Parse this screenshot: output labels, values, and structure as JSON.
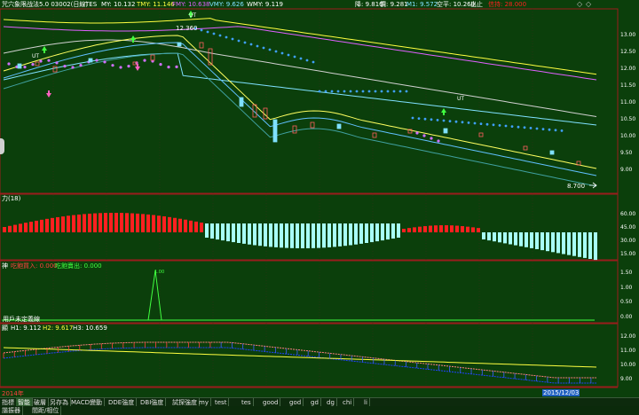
{
  "colors": {
    "bg": "#0b3f0b",
    "grid": "#4a1a1a",
    "axis": "#9b1c1c",
    "yellow": "#ffff40",
    "cyan": "#7fe0ff",
    "magenta": "#e060ff",
    "red": "#ff2020",
    "lightcyan": "#a8fff8",
    "blue": "#2040ff",
    "white": "#ffffff",
    "green": "#40ff40"
  },
  "main": {
    "title": "咒穴象限战法5.0 03002(日線)",
    "legend": [
      {
        "label": "TES",
        "color": "#ffffff"
      },
      {
        "label": "MY: 10.132",
        "color": "#ffffff"
      },
      {
        "label": "TMY: 11.146",
        "color": "#ffff40"
      },
      {
        "label": "FMY: 10.638",
        "color": "#e060ff"
      },
      {
        "label": "VMY: 9.626",
        "color": "#7fe0ff"
      },
      {
        "label": "WMY: 9.119",
        "color": "#ffffff"
      }
    ],
    "right_legend": [
      {
        "label": "降: 9.810",
        "color": "#ffffff"
      },
      {
        "label": "價: 9.281",
        "color": "#ffffff"
      },
      {
        "label": "M1: 9.572",
        "color": "#7fe0ff"
      },
      {
        "label": "空平: 10.260",
        "color": "#ffffff"
      },
      {
        "label": "出止",
        "color": "#ffffff"
      },
      {
        "label": "信持: 28.000",
        "color": "#ff2020"
      }
    ],
    "axis_labels": [
      "13.00",
      "12.50",
      "12.00",
      "11.50",
      "11.00",
      "10.50",
      "10.00",
      "9.50",
      "9.00"
    ],
    "annotations": {
      "high": "12.360",
      "low": "8.700",
      "ut1": "UT",
      "ut2": "UT",
      "ut3": "UT"
    }
  },
  "panel2": {
    "title": "力(18)",
    "axis_labels": [
      "60.00",
      "45.00",
      "30.00",
      "15.00"
    ]
  },
  "panel3": {
    "title_prefix": "神",
    "buy_label": "吃飽買入: 0.000",
    "sell_label": "吃飽賣出: 0.000",
    "bottom_note": "用戶未定義線",
    "axis_labels": [
      "1.50",
      "1.00",
      "0.50",
      "0.00"
    ],
    "spike_label": "1.00"
  },
  "panel4": {
    "title_prefix": "顯",
    "h1": "H1: 9.112",
    "h2": "H2: 9.617",
    "h3": "H3: 10.659",
    "axis_labels": [
      "12.00",
      "11.00",
      "10.00",
      "9.00"
    ]
  },
  "date_axis": {
    "left_label": "2014年",
    "right_label": "2015/12/03",
    "right_label_color": "#2060c0"
  },
  "tabs": [
    {
      "label": "指標",
      "active": false
    },
    {
      "label": "智能",
      "active": true
    },
    {
      "label": "破層",
      "active": false
    },
    {
      "label": "另存為",
      "active": false
    },
    {
      "label": "MACD變動",
      "active": false
    },
    {
      "label": "DDE強度",
      "active": false
    },
    {
      "label": "DBI強度",
      "active": false
    },
    {
      "label": "試探強度",
      "active": false
    },
    {
      "label": "my",
      "active": false
    },
    {
      "label": "test",
      "active": false
    },
    {
      "label": "tes",
      "active": false
    },
    {
      "label": "good",
      "active": false
    },
    {
      "label": "god",
      "active": false
    },
    {
      "label": "gd",
      "active": false
    },
    {
      "label": "dg",
      "active": false
    },
    {
      "label": "chi",
      "active": false
    },
    {
      "label": "li",
      "active": false
    }
  ],
  "status_bar": [
    {
      "label": "諧振器"
    },
    {
      "label": "間距/相位"
    }
  ]
}
